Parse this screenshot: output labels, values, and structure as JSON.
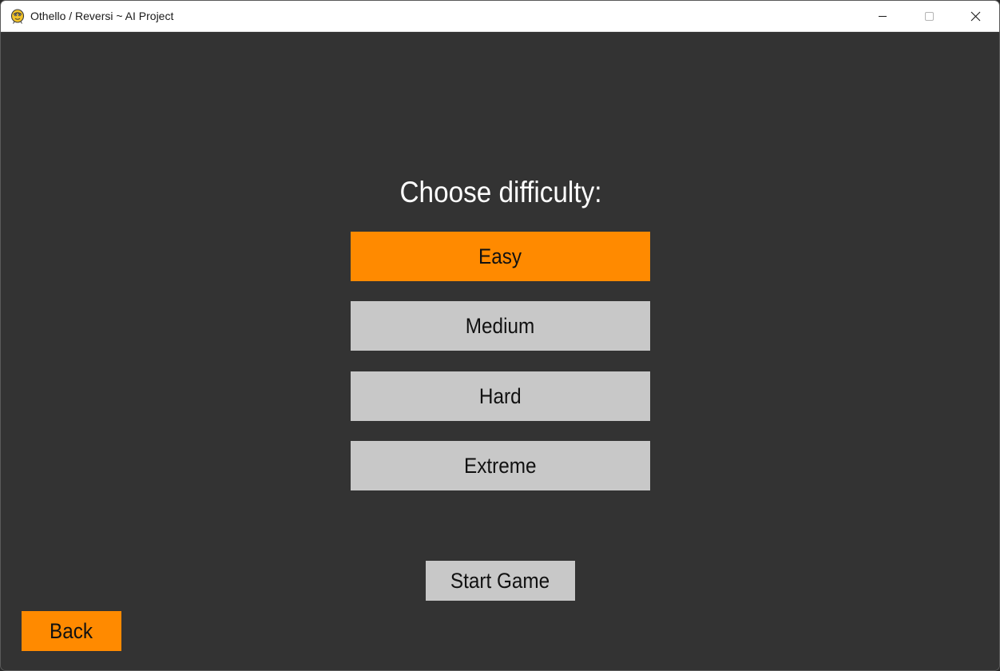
{
  "window": {
    "title": "Othello / Reversi ~ AI Project",
    "icon": "python-snake-icon",
    "controls": [
      "minimize-icon",
      "maximize-icon",
      "close-icon"
    ]
  },
  "menu": {
    "heading": "Choose difficulty:",
    "options": [
      {
        "label": "Easy",
        "selected": true
      },
      {
        "label": "Medium",
        "selected": false
      },
      {
        "label": "Hard",
        "selected": false
      },
      {
        "label": "Extreme",
        "selected": false
      }
    ],
    "start_label": "Start Game",
    "back_label": "Back"
  },
  "colors": {
    "background": "#333333",
    "accent": "#ff8a00",
    "button": "#c8c8c8",
    "heading_text": "#ffffff",
    "button_text": "#111111"
  }
}
